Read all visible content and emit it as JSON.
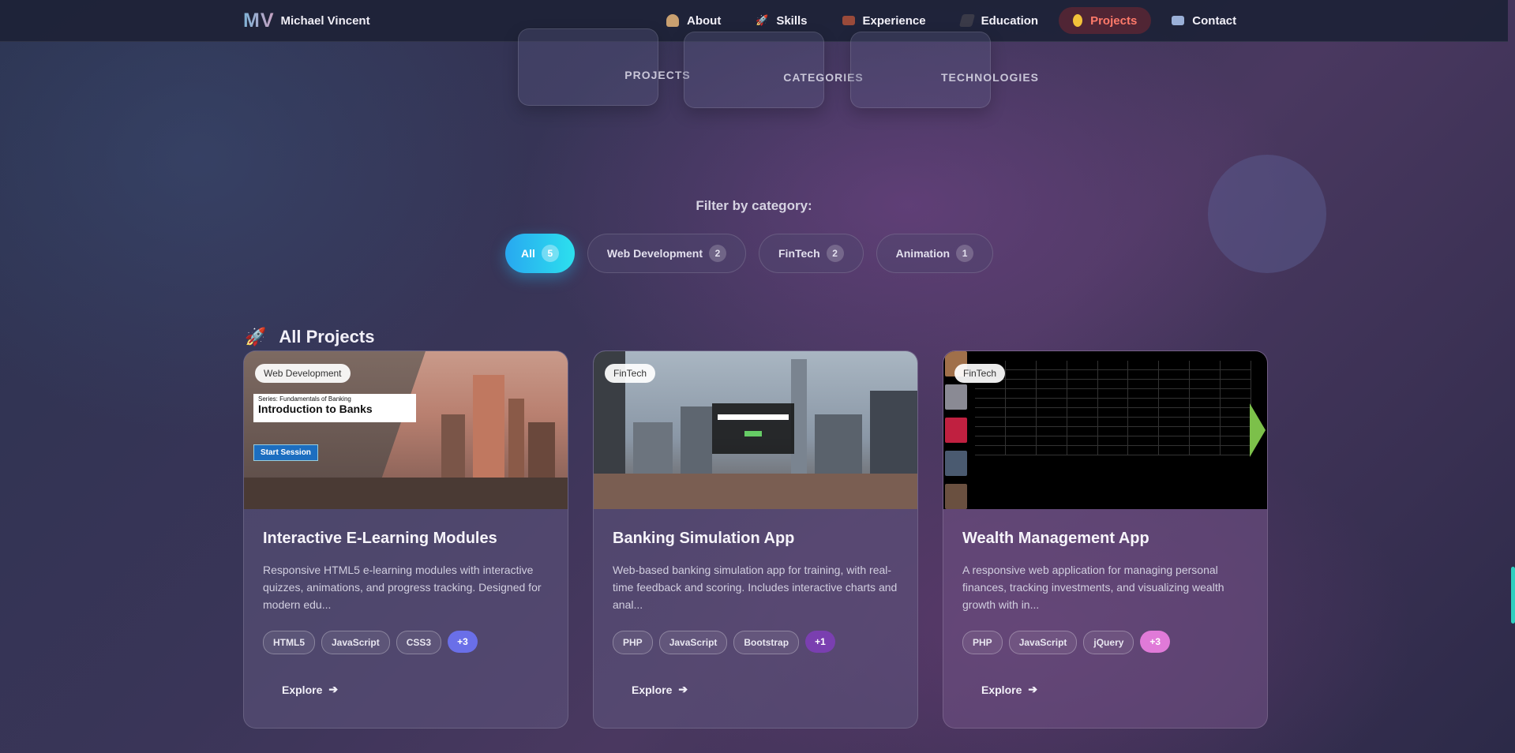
{
  "nav": {
    "logo": "MV",
    "name": "Michael Vincent",
    "links": [
      {
        "label": "About",
        "icon": "person-icon",
        "active": false
      },
      {
        "label": "Skills",
        "icon": "rocket-icon",
        "active": false
      },
      {
        "label": "Experience",
        "icon": "briefcase-icon",
        "active": false
      },
      {
        "label": "Education",
        "icon": "graduation-icon",
        "active": false
      },
      {
        "label": "Projects",
        "icon": "lightbulb-icon",
        "active": true
      },
      {
        "label": "Contact",
        "icon": "mail-icon",
        "active": false
      }
    ]
  },
  "stats": [
    {
      "label": "PROJECTS"
    },
    {
      "label": "CATEGORIES"
    },
    {
      "label": "TECHNOLOGIES"
    }
  ],
  "filter": {
    "label": "Filter by category:",
    "chips": [
      {
        "label": "All",
        "count": "5",
        "active": true
      },
      {
        "label": "Web Development",
        "count": "2",
        "active": false
      },
      {
        "label": "FinTech",
        "count": "2",
        "active": false
      },
      {
        "label": "Animation",
        "count": "1",
        "active": false
      }
    ]
  },
  "section": {
    "title": "All Projects"
  },
  "cards": [
    {
      "badge": "Web Development",
      "title": "Interactive E-Learning Modules",
      "desc": "Responsive HTML5 e-learning modules with interactive quizzes, animations, and progress tracking. Designed for modern edu...",
      "tags": [
        "HTML5",
        "JavaScript",
        "CSS3"
      ],
      "more": "+3",
      "more_color": "#6a6fe8",
      "explore": "Explore",
      "image": {
        "series": "Series: Fundamentals of Banking",
        "heading": "Introduction to Banks",
        "button": "Start Session"
      }
    },
    {
      "badge": "FinTech",
      "title": "Banking Simulation App",
      "desc": "Web-based banking simulation app for training, with real-time feedback and scoring. Includes interactive charts and anal...",
      "tags": [
        "PHP",
        "JavaScript",
        "Bootstrap"
      ],
      "more": "+1",
      "more_color": "#7a3fb0",
      "explore": "Explore"
    },
    {
      "badge": "FinTech",
      "title": "Wealth Management App",
      "desc": "A responsive web application for managing personal finances, tracking investments, and visualizing wealth growth with in...",
      "tags": [
        "PHP",
        "JavaScript",
        "jQuery"
      ],
      "more": "+3",
      "more_color": "#e07ad8",
      "explore": "Explore"
    }
  ]
}
